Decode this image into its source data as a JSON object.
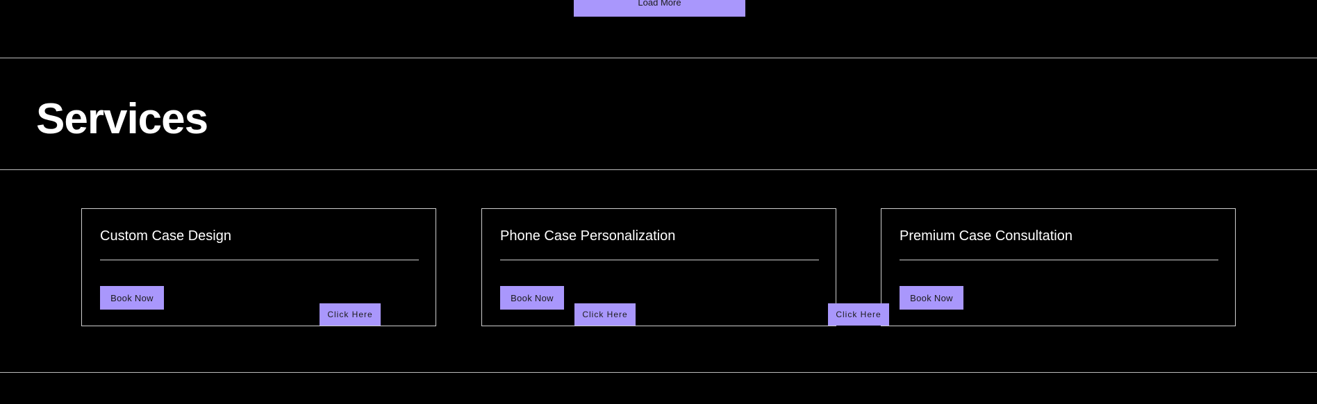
{
  "load_more": {
    "label": "Load More"
  },
  "services": {
    "title": "Services",
    "cards": [
      {
        "title": "Custom Case Design",
        "button_label": "Book Now"
      },
      {
        "title": "Phone Case Personalization",
        "button_label": "Book Now"
      },
      {
        "title": "Premium Case Consultation",
        "button_label": "Book Now"
      }
    ]
  },
  "floating_buttons": [
    {
      "label": "Click Here"
    },
    {
      "label": "Click Here"
    },
    {
      "label": "Click Here"
    }
  ],
  "colors": {
    "background": "#000000",
    "accent": "#a997fc",
    "text": "#ffffff",
    "button_text": "#1a1a1a",
    "rule": "#bdbdbd"
  }
}
